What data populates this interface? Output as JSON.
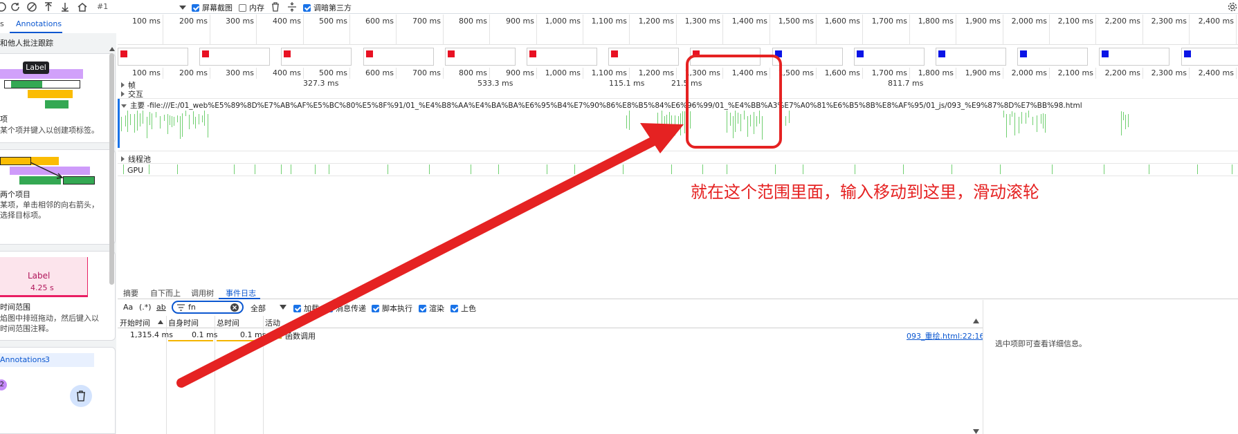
{
  "toolbar": {
    "record_counter": "#1",
    "screenshots_label": "屏幕截图",
    "memory_label": "内存",
    "dim_third_party_label": "调暗第三方"
  },
  "sidebar": {
    "tab_partial": "s",
    "tab_annotations": "Annotations",
    "intro_text": "和他人批注跟踪",
    "card1": {
      "title": "项",
      "desc": "某个项并键入以创建项标签。",
      "label_demo": "Label"
    },
    "card2": {
      "title": "两个项目",
      "desc1": "某项，单击相邻的向右箭头，",
      "desc2": "选择目标项。"
    },
    "card3": {
      "label": "Label",
      "time": "4.25 s",
      "title": "时间范围",
      "desc1": "焰图中排班拖动，然后键入以",
      "desc2": "时间范围注释。"
    },
    "annotations_header": "Annotations",
    "annotations_count": "3",
    "badge": "2"
  },
  "ruler_ticks": [
    "100 ms",
    "200 ms",
    "300 ms",
    "400 ms",
    "500 ms",
    "600 ms",
    "700 ms",
    "800 ms",
    "900 ms",
    "1,000 ms",
    "1,100 ms",
    "1,200 ms",
    "1,300 ms",
    "1,400 ms",
    "1,500 ms",
    "1,600 ms",
    "1,700 ms",
    "1,800 ms",
    "1,900 ms",
    "2,000 ms",
    "2,100 ms",
    "2,200 ms",
    "2,300 ms",
    "2,400 ms"
  ],
  "ruler2_ticks": [
    "100 ms",
    "200 ms",
    "300 ms",
    "400 ms",
    "500 ms",
    "600 ms",
    "700 ms",
    "800 ms",
    "900 ms",
    "1,000 ms",
    "1,100 ms",
    "1,200 ms",
    "1,300 ms",
    "1,400 ms",
    "1,500 ms",
    "1,600 ms",
    "1,700 ms",
    "1,800 ms",
    "1,900 ms",
    "2,000 ms",
    "2,100 ms",
    "2,200 ms",
    "2,300 ms",
    "2,400 ms"
  ],
  "tracks": {
    "frames_label": "帧",
    "frame_values": [
      "327.3 ms",
      "533.3 ms",
      "115.1 ms",
      "21.5 ms",
      "811.7 ms"
    ],
    "interaction_label": "交互",
    "main_label": "主要 -file:///E:/01_web%E5%89%8D%E7%AB%AF%E5%BC%80%E5%8F%91/01_%E4%B8%AA%E4%BA%BA%E6%95%B4%E7%90%86%E8%B5%84%E6%96%99/01_%E4%BB%A3%E7%A0%81%E6%B5%8B%E8%AF%95/01_js/093_%E9%87%8D%E7%BB%98.html",
    "threadpool_label": "线程池",
    "gpu_label": "GPU"
  },
  "screenshot_colors": [
    "#e81123",
    "#e81123",
    "#e81123",
    "#e81123",
    "#e81123",
    "#e81123",
    "#e81123",
    "#e81123",
    "#0a14e6",
    "#0a14e6",
    "#0a14e6",
    "#0a14e6",
    "#0a14e6",
    "#0a14e6"
  ],
  "bottom_tabs": [
    "摘要",
    "自下而上",
    "调用树",
    "事件日志"
  ],
  "filter": {
    "match_case": "Aa",
    "regex": "(.*)",
    "whole_word": "ab",
    "value": "fn",
    "category_select": "全部",
    "checks": [
      "加载",
      "消息传递",
      "脚本执行",
      "渲染",
      "上色"
    ]
  },
  "table": {
    "headers": [
      "开始时间",
      "自身时间",
      "总时间",
      "活动"
    ],
    "row": {
      "start": "1,315.4 ms",
      "self": "0.1 ms",
      "total": "0.1 ms",
      "activity": "函数调用",
      "source": "093_重绘.html:22:16"
    }
  },
  "detail_hint": "选中项即可查看详细信息。",
  "annotation": {
    "text": "就在这个范围里面，输入移动到这里，滑动滚轮",
    "color": "#e52222"
  }
}
